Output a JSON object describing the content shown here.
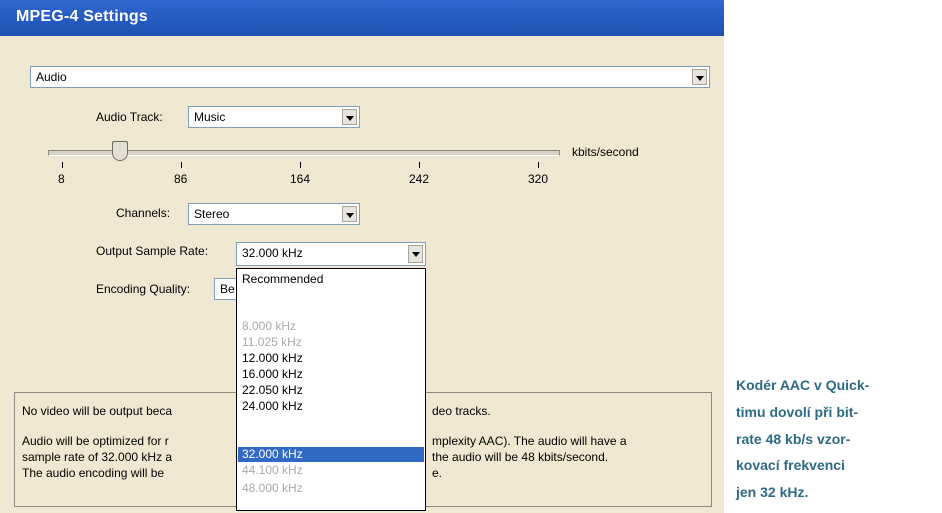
{
  "window": {
    "title": "MPEG-4 Settings"
  },
  "section_select": {
    "value": "Audio"
  },
  "audio_track": {
    "label": "Audio Track:",
    "value": "Music"
  },
  "bitrate": {
    "unit_label": "kbits/second",
    "ticks": [
      "8",
      "86",
      "164",
      "242",
      "320"
    ],
    "value_kbps": 48
  },
  "channels": {
    "label": "Channels:",
    "value": "Stereo"
  },
  "output_sample_rate": {
    "label": "Output Sample Rate:",
    "value": "32.000 kHz"
  },
  "encoding_quality": {
    "label": "Encoding Quality:",
    "value": "Be"
  },
  "sample_rate_dropdown": {
    "header": "Recommended",
    "options": [
      {
        "label": "8.000 kHz",
        "state": "disabled"
      },
      {
        "label": "11.025 kHz",
        "state": "disabled"
      },
      {
        "label": "12.000 kHz",
        "state": "enabled"
      },
      {
        "label": "16.000 kHz",
        "state": "enabled"
      },
      {
        "label": "22.050 kHz",
        "state": "enabled"
      },
      {
        "label": "24.000 kHz",
        "state": "enabled"
      },
      {
        "label": "32.000 kHz",
        "state": "selected"
      },
      {
        "label": "44.100 kHz",
        "state": "disabled"
      },
      {
        "label": "48.000 kHz",
        "state": "disabled"
      }
    ]
  },
  "info_panel": {
    "line1_a": "No video will be output beca",
    "line1_b": "deo tracks.",
    "line2_a": "Audio will be optimized for r",
    "line2_b": "mplexity AAC).  The audio will have a",
    "line3_a": "sample rate of 32.000 kHz a",
    "line3_b": "the audio will be 48 kbits/second.",
    "line4_a": "The audio encoding will be",
    "line4_b": "e."
  },
  "caption": {
    "lines": [
      "Kodér AAC v Quick-",
      "timu dovolí při bit-",
      "rate 48 kb/s vzor-",
      "kovací frekvenci",
      "jen 32 kHz."
    ]
  },
  "colors": {
    "titlebar": "#245bc0",
    "dialog_bg": "#efe7d1",
    "selection": "#316ac5",
    "caption_text": "#2c6b84"
  }
}
